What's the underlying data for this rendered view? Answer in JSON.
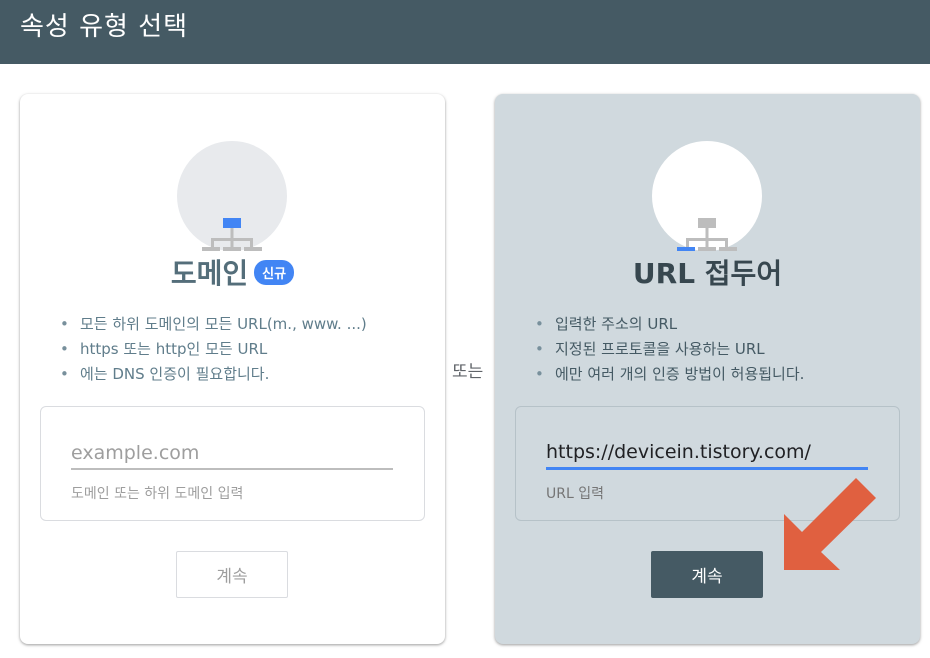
{
  "header": {
    "title": "속성 유형 선택"
  },
  "domain_card": {
    "title": "도메인",
    "badge": "신규",
    "bullets": [
      "모든 하위 도메인의 모든 URL(m., www. ...)",
      "https 또는 http인 모든 URL",
      "에는 DNS 인증이 필요합니다."
    ],
    "input_placeholder": "example.com",
    "input_value": "",
    "input_hint": "도메인 또는 하위 도메인 입력",
    "button_label": "계속",
    "button_enabled": false
  },
  "separator": {
    "label": "또는"
  },
  "url_card": {
    "title": "URL 접두어",
    "bullets": [
      "입력한 주소의 URL",
      "지정된 프로토콜을 사용하는 URL",
      "에만 여러 개의 인증 방법이 허용됩니다."
    ],
    "input_value": "https://devicein.tistory.com/",
    "input_hint": "URL 입력",
    "button_label": "계속",
    "button_enabled": true
  },
  "icons": {
    "domain_icon": "sitemap-root-highlight-icon",
    "url_prefix_icon": "sitemap-leaf-highlight-icon",
    "annotation_arrow": "arrow-down-left-icon"
  },
  "colors": {
    "header_bg": "#455a64",
    "accent_blue": "#4285f4",
    "selected_card_bg": "#d0d9de",
    "primary_button": "#455a64",
    "annotation_arrow": "#e06040"
  }
}
